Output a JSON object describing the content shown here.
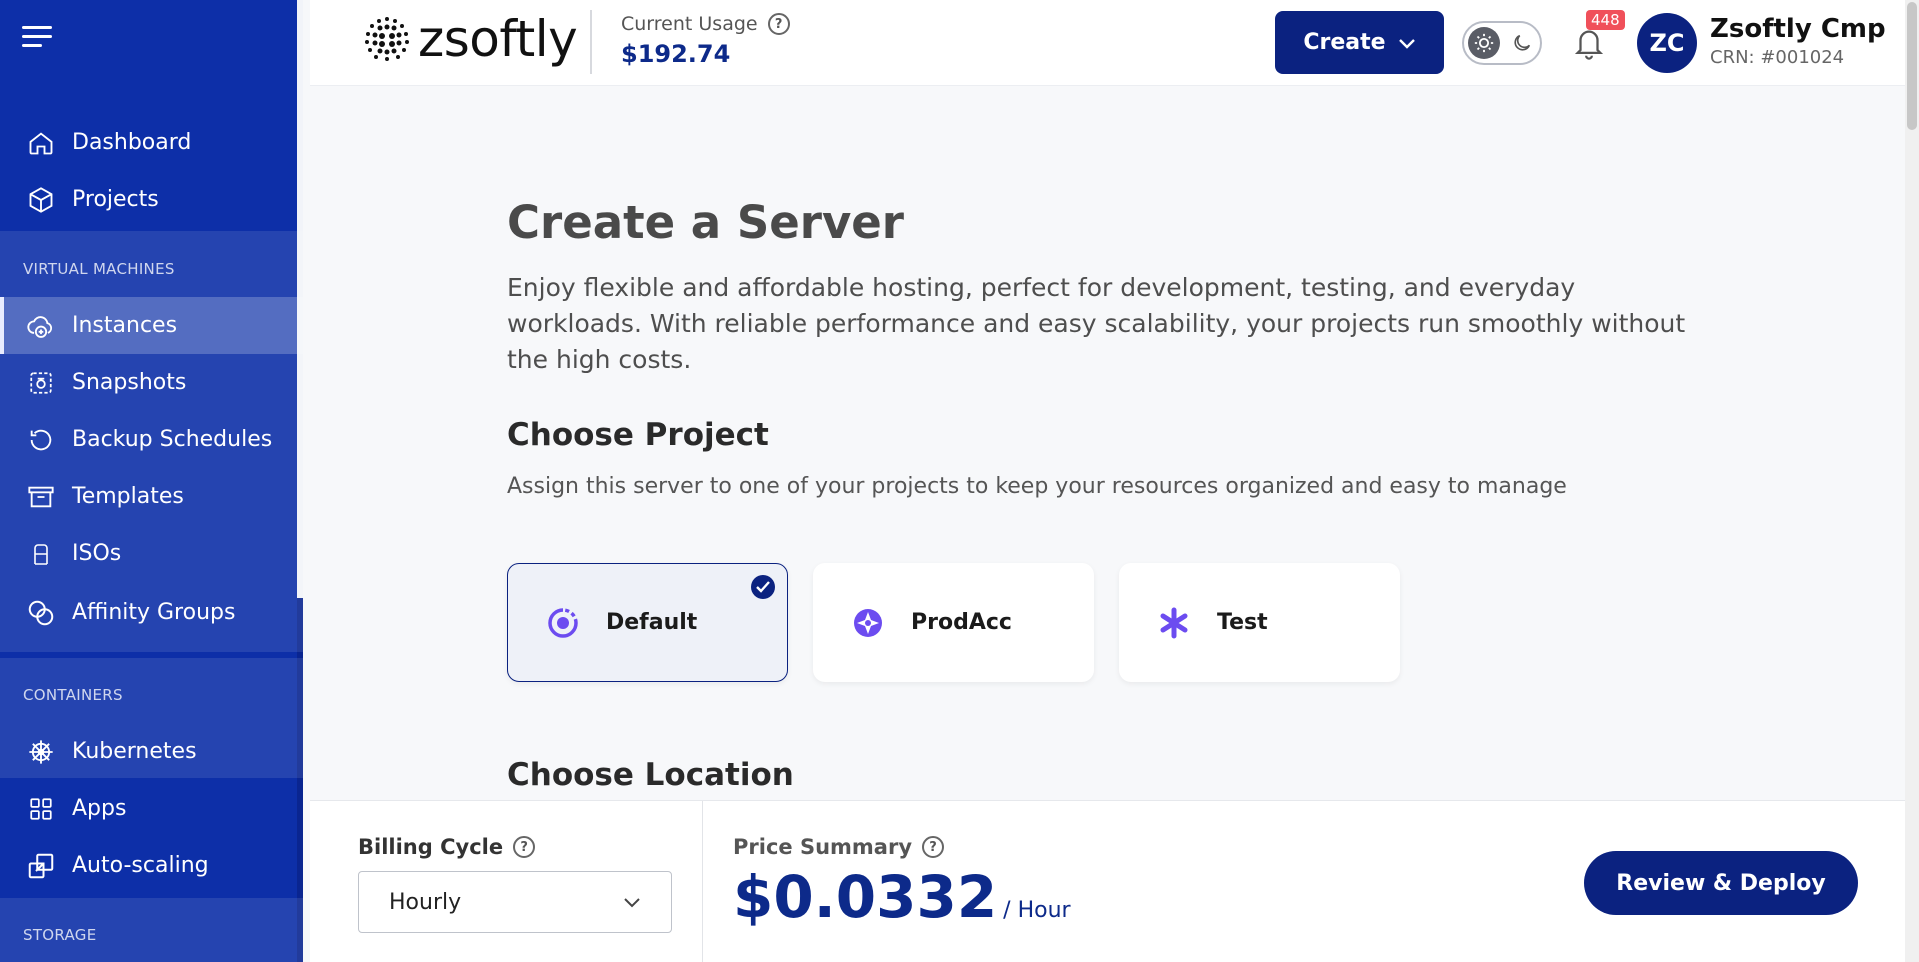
{
  "sidebar": {
    "items": [
      {
        "label": "Dashboard",
        "icon": "home-icon"
      },
      {
        "label": "Projects",
        "icon": "cube-icon"
      },
      {
        "label": "Instances",
        "icon": "cloud-plus-icon",
        "active": true
      },
      {
        "label": "Snapshots",
        "icon": "camera-icon"
      },
      {
        "label": "Backup Schedules",
        "icon": "history-icon"
      },
      {
        "label": "Templates",
        "icon": "archive-box-icon"
      },
      {
        "label": "ISOs",
        "icon": "disc-icon"
      },
      {
        "label": "Affinity Groups",
        "icon": "circles-icon"
      },
      {
        "label": "Kubernetes",
        "icon": "helm-wheel-icon"
      },
      {
        "label": "Apps",
        "icon": "grid-icon"
      },
      {
        "label": "Auto-scaling",
        "icon": "scale-arrows-icon"
      }
    ],
    "sections": {
      "virtual_machines": "VIRTUAL MACHINES",
      "containers": "CONTAINERS",
      "storage": "STORAGE"
    }
  },
  "header": {
    "logo_text": "zsoftly",
    "usage_label": "Current Usage",
    "usage_value": "$192.74",
    "create_label": "Create",
    "notification_count": "448",
    "avatar_initials": "ZC",
    "user_name": "Zsoftly Cmp",
    "user_crn": "CRN: #001024"
  },
  "main": {
    "title": "Create a Server",
    "description": "Enjoy flexible and affordable hosting, perfect for development, testing, and everyday workloads. With reliable performance and easy scalability, your projects run smoothly without the high costs.",
    "choose_project_title": "Choose Project",
    "choose_project_desc": "Assign this server to one of your projects to keep your resources organized and easy to manage",
    "projects": [
      {
        "name": "Default",
        "selected": true
      },
      {
        "name": "ProdAcc",
        "selected": false
      },
      {
        "name": "Test",
        "selected": false
      }
    ],
    "choose_location_title": "Choose Location"
  },
  "footer": {
    "billing_label": "Billing Cycle",
    "billing_value": "Hourly",
    "price_label": "Price Summary",
    "price_value": "$0.0332",
    "price_unit": "/ Hour",
    "deploy_label": "Review & Deploy"
  },
  "colors": {
    "sidebar_bg": "#0d2fa8",
    "primary": "#0b2280",
    "accent_purple": "#6c4cf0",
    "badge_red": "#f0505a"
  }
}
